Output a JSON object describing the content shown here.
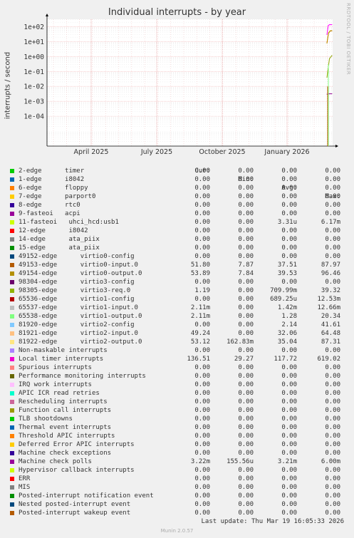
{
  "title": "Individual interrupts - by year",
  "watermark": "RRDTOOL / TOBI OETIKER",
  "chart_data": {
    "type": "line",
    "title": "Individual interrupts - by year",
    "ylabel": "interrupts / second",
    "yscale": "log",
    "ylim": [
      1e-06,
      316
    ],
    "y_ticks": [
      {
        "value": 100,
        "label": "1e+02"
      },
      {
        "value": 10,
        "label": "1e+01"
      },
      {
        "value": 1,
        "label": "1e+00"
      },
      {
        "value": 0.1,
        "label": "1e-01"
      },
      {
        "value": 0.01,
        "label": "1e-02"
      },
      {
        "value": 0.001,
        "label": "1e-03"
      },
      {
        "value": 0.0001,
        "label": "1e-04"
      }
    ],
    "x_ticks": [
      "April 2025",
      "July 2025",
      "October 2025",
      "January 2026"
    ],
    "grid": true,
    "series": [
      {
        "name": "Local timer interrupts",
        "color": "#ff00ff",
        "values": [
          29.27,
          117.72,
          136.51,
          136.51,
          136.51
        ]
      },
      {
        "name": "49153-edge virtio0-input.0",
        "color": "#bf5b00",
        "values": [
          7.87,
          37.51,
          51.8,
          51.8
        ]
      },
      {
        "name": "49154-edge virtio0-output.0",
        "color": "#bf9500",
        "values": [
          7.84,
          39.53,
          53.89,
          53.89
        ]
      },
      {
        "name": "98305-edge virtio3-req.0",
        "color": "#8fa300",
        "values": [
          0.0393,
          0.71,
          1.19
        ]
      },
      {
        "name": "Machine check polls",
        "color": "#8f008f",
        "values": [
          0.003,
          0.0032,
          0.0032
        ]
      }
    ]
  },
  "legend": {
    "headers": {
      "cur": "Cur:",
      "min": "Min:",
      "avg": "Avg:",
      "max": "Max:"
    },
    "rows": [
      {
        "name": "2-edge      timer",
        "color": "#00cc00",
        "cur": "0.00",
        "min": "0.00",
        "avg": "0.00",
        "max": "0.00"
      },
      {
        "name": "1-edge      i8042",
        "color": "#0066b3",
        "cur": "0.00",
        "min": "0.00",
        "avg": "0.00",
        "max": "0.00"
      },
      {
        "name": "6-edge      floppy",
        "color": "#ff8000",
        "cur": "0.00",
        "min": "0.00",
        "avg": "0.00",
        "max": "0.00"
      },
      {
        "name": "7-edge      parport0",
        "color": "#ffcc00",
        "cur": "0.00",
        "min": "0.00",
        "avg": "0.00",
        "max": "0.00"
      },
      {
        "name": "8-edge      rtc0",
        "color": "#330099",
        "cur": "0.00",
        "min": "0.00",
        "avg": "0.00",
        "max": "0.00"
      },
      {
        "name": "9-fasteoi   acpi",
        "color": "#990099",
        "cur": "0.00",
        "min": "0.00",
        "avg": "0.00",
        "max": "0.00"
      },
      {
        "name": "11-fasteoi   uhci_hcd:usb1",
        "color": "#ccff00",
        "cur": "0.00",
        "min": "0.00",
        "avg": "3.31u",
        "max": "6.17m"
      },
      {
        "name": "12-edge      i8042",
        "color": "#ff0000",
        "cur": "0.00",
        "min": "0.00",
        "avg": "0.00",
        "max": "0.00"
      },
      {
        "name": "14-edge      ata_piix",
        "color": "#808080",
        "cur": "0.00",
        "min": "0.00",
        "avg": "0.00",
        "max": "0.00"
      },
      {
        "name": "15-edge      ata_piix",
        "color": "#008f00",
        "cur": "0.00",
        "min": "0.00",
        "avg": "0.00",
        "max": "0.00"
      },
      {
        "name": "49152-edge      virtio0-config",
        "color": "#00487d",
        "cur": "0.00",
        "min": "0.00",
        "avg": "0.00",
        "max": "0.00"
      },
      {
        "name": "49153-edge      virtio0-input.0",
        "color": "#b35a00",
        "cur": "51.80",
        "min": "7.87",
        "avg": "37.51",
        "max": "87.97"
      },
      {
        "name": "49154-edge      virtio0-output.0",
        "color": "#b38f00",
        "cur": "53.89",
        "min": "7.84",
        "avg": "39.53",
        "max": "96.46"
      },
      {
        "name": "98304-edge      virtio3-config",
        "color": "#6b006b",
        "cur": "0.00",
        "min": "0.00",
        "avg": "0.00",
        "max": "0.00"
      },
      {
        "name": "98305-edge      virtio3-req.0",
        "color": "#8fb300",
        "cur": "1.19",
        "min": "0.00",
        "avg": "709.99m",
        "max": "39.32"
      },
      {
        "name": "65536-edge      virtio1-config",
        "color": "#b30000",
        "cur": "0.00",
        "min": "0.00",
        "avg": "689.25u",
        "max": "12.53m"
      },
      {
        "name": "65537-edge      virtio1-input.0",
        "color": "#bebebe",
        "cur": "2.11m",
        "min": "0.00",
        "avg": "1.42m",
        "max": "12.66m"
      },
      {
        "name": "65538-edge      virtio1-output.0",
        "color": "#80ff80",
        "cur": "2.11m",
        "min": "0.00",
        "avg": "1.28",
        "max": "20.34"
      },
      {
        "name": "81920-edge      virtio2-config",
        "color": "#80c9ff",
        "cur": "0.00",
        "min": "0.00",
        "avg": "2.14",
        "max": "41.61"
      },
      {
        "name": "81921-edge      virtio2-input.0",
        "color": "#ffc080",
        "cur": "49.24",
        "min": "0.00",
        "avg": "32.06",
        "max": "64.48"
      },
      {
        "name": "81922-edge      virtio2-output.0",
        "color": "#ffe680",
        "cur": "53.12",
        "min": "162.83m",
        "avg": "35.04",
        "max": "87.31"
      },
      {
        "name": "Non-maskable interrupts",
        "color": "#aa80ff",
        "cur": "0.00",
        "min": "0.00",
        "avg": "0.00",
        "max": "0.00"
      },
      {
        "name": "Local timer interrupts",
        "color": "#ee00cc",
        "cur": "136.51",
        "min": "29.27",
        "avg": "117.72",
        "max": "619.02"
      },
      {
        "name": "Spurious interrupts",
        "color": "#ff8080",
        "cur": "0.00",
        "min": "0.00",
        "avg": "0.00",
        "max": "0.00"
      },
      {
        "name": "Performance monitoring interrupts",
        "color": "#666600",
        "cur": "0.00",
        "min": "0.00",
        "avg": "0.00",
        "max": "0.00"
      },
      {
        "name": "IRQ work interrupts",
        "color": "#ffbfff",
        "cur": "0.00",
        "min": "0.00",
        "avg": "0.00",
        "max": "0.00"
      },
      {
        "name": "APIC ICR read retries",
        "color": "#00ffcc",
        "cur": "0.00",
        "min": "0.00",
        "avg": "0.00",
        "max": "0.00"
      },
      {
        "name": "Rescheduling interrupts",
        "color": "#cc6699",
        "cur": "0.00",
        "min": "0.00",
        "avg": "0.00",
        "max": "0.00"
      },
      {
        "name": "Function call interrupts",
        "color": "#999900",
        "cur": "0.00",
        "min": "0.00",
        "avg": "0.00",
        "max": "0.00"
      },
      {
        "name": "TLB shootdowns",
        "color": "#00cc00",
        "cur": "0.00",
        "min": "0.00",
        "avg": "0.00",
        "max": "0.00"
      },
      {
        "name": "Thermal event interrupts",
        "color": "#0066b3",
        "cur": "0.00",
        "min": "0.00",
        "avg": "0.00",
        "max": "0.00"
      },
      {
        "name": "Threshold APIC interrupts",
        "color": "#ff8000",
        "cur": "0.00",
        "min": "0.00",
        "avg": "0.00",
        "max": "0.00"
      },
      {
        "name": "Deferred Error APIC interrupts",
        "color": "#ffcc00",
        "cur": "0.00",
        "min": "0.00",
        "avg": "0.00",
        "max": "0.00"
      },
      {
        "name": "Machine check exceptions",
        "color": "#330099",
        "cur": "0.00",
        "min": "0.00",
        "avg": "0.00",
        "max": "0.00"
      },
      {
        "name": "Machine check polls",
        "color": "#990099",
        "cur": "3.22m",
        "min": "155.56u",
        "avg": "3.21m",
        "max": "6.00m"
      },
      {
        "name": "Hypervisor callback interrupts",
        "color": "#ccff00",
        "cur": "0.00",
        "min": "0.00",
        "avg": "0.00",
        "max": "0.00"
      },
      {
        "name": "ERR",
        "color": "#ff0000",
        "cur": "0.00",
        "min": "0.00",
        "avg": "0.00",
        "max": "0.00"
      },
      {
        "name": "MIS",
        "color": "#808080",
        "cur": "0.00",
        "min": "0.00",
        "avg": "0.00",
        "max": "0.00"
      },
      {
        "name": "Posted-interrupt notification event",
        "color": "#008f00",
        "cur": "0.00",
        "min": "0.00",
        "avg": "0.00",
        "max": "0.00"
      },
      {
        "name": "Nested posted-interrupt event",
        "color": "#00487d",
        "cur": "0.00",
        "min": "0.00",
        "avg": "0.00",
        "max": "0.00"
      },
      {
        "name": "Posted-interrupt wakeup event",
        "color": "#b35a00",
        "cur": "0.00",
        "min": "0.00",
        "avg": "0.00",
        "max": "0.00"
      }
    ]
  },
  "last_update": "Last update: Thu Mar 19 16:05:33 2026",
  "footer": "Munin 2.0.57"
}
